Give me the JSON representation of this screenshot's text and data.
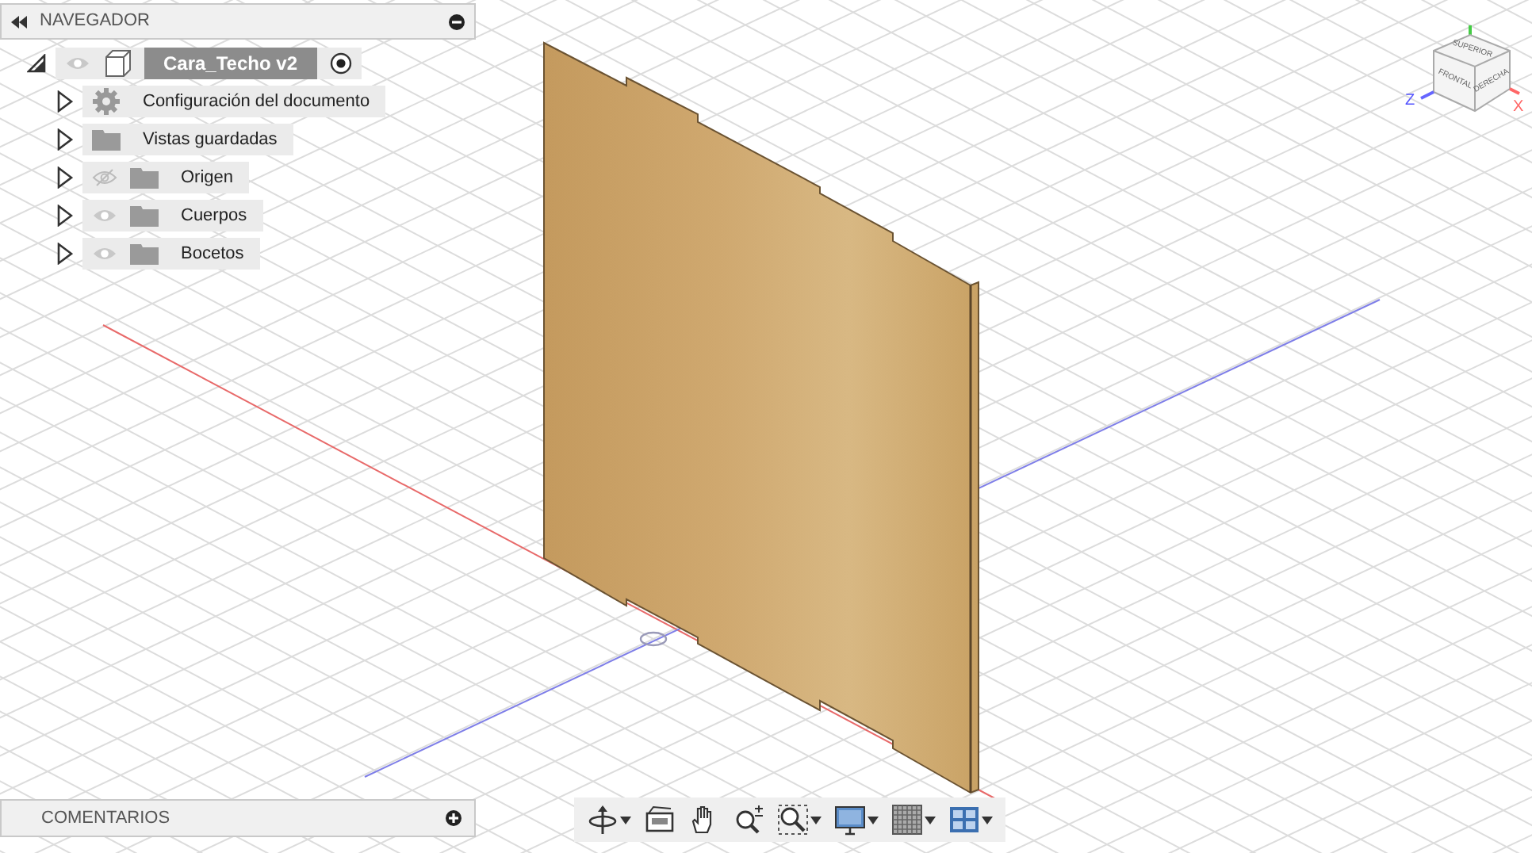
{
  "navigator": {
    "title": "NAVEGADOR",
    "root": {
      "label": "Cara_Techo v2",
      "visible": true,
      "expanded": true,
      "active": true,
      "children": [
        {
          "label": "Configuración del documento",
          "kind": "settings",
          "expanded": false
        },
        {
          "label": "Vistas guardadas",
          "kind": "folder",
          "expanded": false
        },
        {
          "label": "Origen",
          "kind": "folder",
          "visible": false,
          "expanded": false
        },
        {
          "label": "Cuerpos",
          "kind": "folder",
          "visible": true,
          "expanded": false
        },
        {
          "label": "Bocetos",
          "kind": "folder",
          "visible": true,
          "expanded": false
        }
      ]
    }
  },
  "comments": {
    "title": "COMENTARIOS"
  },
  "view_cube": {
    "faces": [
      "SUPERIOR",
      "FRONTAL",
      "DERECHA"
    ],
    "axes": [
      "Z",
      "X"
    ]
  },
  "toolbar": [
    {
      "kind": "orbit",
      "dropdown": true
    },
    {
      "kind": "look",
      "dropdown": false
    },
    {
      "kind": "pan",
      "dropdown": false
    },
    {
      "kind": "zoom",
      "dropdown": false
    },
    {
      "kind": "fit",
      "dropdown": true
    },
    {
      "kind": "display",
      "dropdown": true
    },
    {
      "kind": "grid",
      "dropdown": true
    },
    {
      "kind": "viewports",
      "dropdown": true
    }
  ]
}
